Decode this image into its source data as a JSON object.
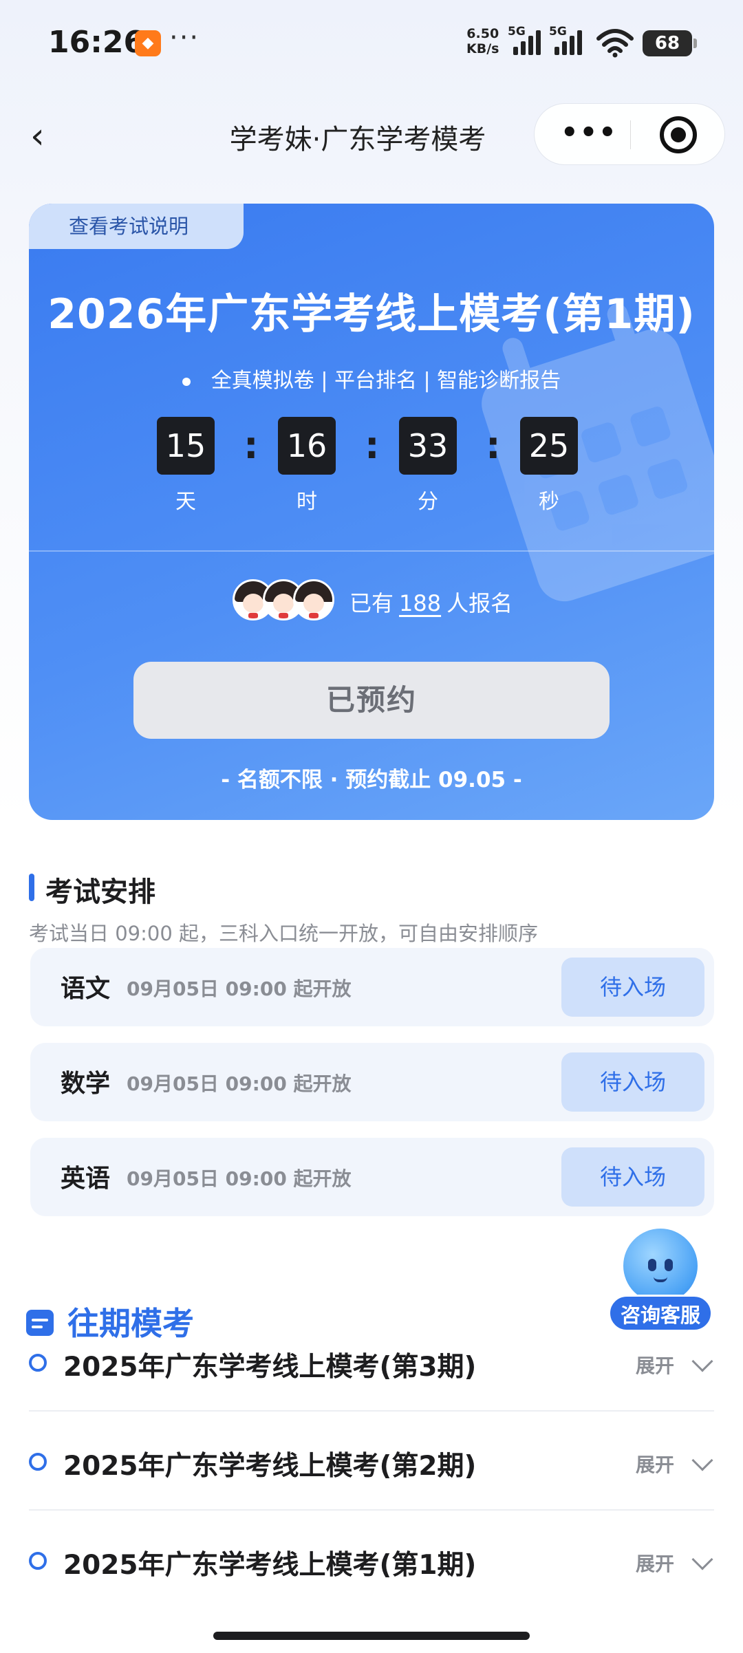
{
  "status_bar": {
    "time": "16:26",
    "more": "···",
    "net_speed_value": "6.50",
    "net_speed_unit": "KB/s",
    "sim1_tag": "5G",
    "sim2_tag": "5G",
    "battery": "68"
  },
  "nav": {
    "back": "‹",
    "title": "学考妹·广东学考模考",
    "capsule_more": "•••"
  },
  "hero": {
    "guide_tab": "查看考试说明",
    "title": "2026年广东学考线上模考(第1期)",
    "subtitle": "全真模拟卷 | 平台排名 | 智能诊断报告",
    "countdown": [
      {
        "value": "15",
        "label": "天"
      },
      {
        "value": "16",
        "label": "时"
      },
      {
        "value": "33",
        "label": "分"
      },
      {
        "value": "25",
        "label": "秒"
      }
    ],
    "signup_prefix": "已有",
    "signup_count": "188",
    "signup_suffix": "人报名",
    "reserved_label": "已预约",
    "quota_text": "- 名额不限 · 预约截止 09.05 -"
  },
  "schedule": {
    "title": "考试安排",
    "description": "考试当日 09:00 起，三科入口统一开放，可自由安排顺序",
    "subjects": [
      {
        "name": "语文",
        "time": "09月05日 09:00 起开放",
        "button": "待入场"
      },
      {
        "name": "数学",
        "time": "09月05日 09:00 起开放",
        "button": "待入场"
      },
      {
        "name": "英语",
        "time": "09月05日 09:00 起开放",
        "button": "待入场"
      }
    ]
  },
  "past": {
    "title": "往期模考",
    "items": [
      {
        "name": "2025年广东学考线上模考(第3期)",
        "expand": "展开"
      },
      {
        "name": "2025年广东学考线上模考(第2期)",
        "expand": "展开"
      },
      {
        "name": "2025年广东学考线上模考(第1期)",
        "expand": "展开"
      }
    ]
  },
  "service": {
    "label": "咨询客服"
  },
  "colors": {
    "accent": "#2f6fe8",
    "hero_bg": "#4a8af4",
    "countdown_box": "#1b1d22",
    "reserved_btn": "#e7e8ec",
    "enter_btn": "#cfe0fb"
  },
  "icons": [
    "back-chevron-icon",
    "more-dots-icon",
    "target-close-icon",
    "calendar-icon",
    "list-icon",
    "chevron-down-icon",
    "wifi-icon",
    "signal-icon",
    "battery-icon",
    "robot-avatar-icon"
  ]
}
